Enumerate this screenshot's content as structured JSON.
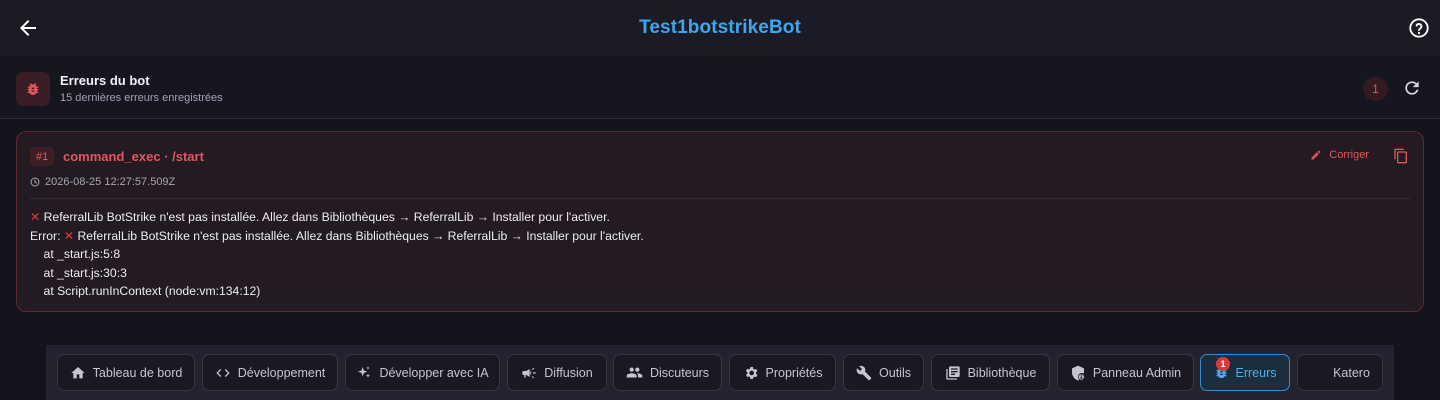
{
  "topbar": {
    "title": "Test1botstrikeBot",
    "back_icon": "arrow-left-icon",
    "help_icon": "help-circle-icon"
  },
  "section": {
    "title": "Erreurs du bot",
    "subtitle": "15 dernières erreurs enregistrées",
    "count": "1",
    "icon": "bug-icon"
  },
  "error": {
    "number": "#1",
    "command": "command_exec · /start",
    "timestamp": "2026-08-25 12:27:57.509Z",
    "fix_label": "Corriger",
    "lines": [
      "ReferralLib BotStrike n'est pas installée. Allez dans Bibliothèques → ReferralLib → Installer pour l'activer.",
      "Error: ",
      "ReferralLib BotStrike n'est pas installée. Allez dans Bibliothèques → ReferralLib → Installer pour l'activer.",
      "    at _start.js:5:8",
      "    at _start.js:30:3",
      "    at Script.runInContext (node:vm:134:12)"
    ]
  },
  "nav": {
    "tabs": [
      {
        "label": "Tableau de bord",
        "icon": "home-icon"
      },
      {
        "label": "Développement",
        "icon": "code-icon"
      },
      {
        "label": "Développer avec IA",
        "icon": "sparkle-icon"
      },
      {
        "label": "Diffusion",
        "icon": "megaphone-icon"
      },
      {
        "label": "Discuteurs",
        "icon": "people-icon"
      },
      {
        "label": "Propriétés",
        "icon": "gear-icon"
      },
      {
        "label": "Outils",
        "icon": "wrench-icon"
      },
      {
        "label": "Bibliothèque",
        "icon": "library-icon"
      },
      {
        "label": "Panneau Admin",
        "icon": "admin-shield-icon"
      },
      {
        "label": "Erreurs",
        "icon": "bug-icon",
        "badge": "1",
        "active": true
      },
      {
        "label": "Katero",
        "icon": ""
      }
    ]
  },
  "colors": {
    "accent": "#3ea6ee",
    "error": "#e3565d",
    "background": "#13131c"
  }
}
